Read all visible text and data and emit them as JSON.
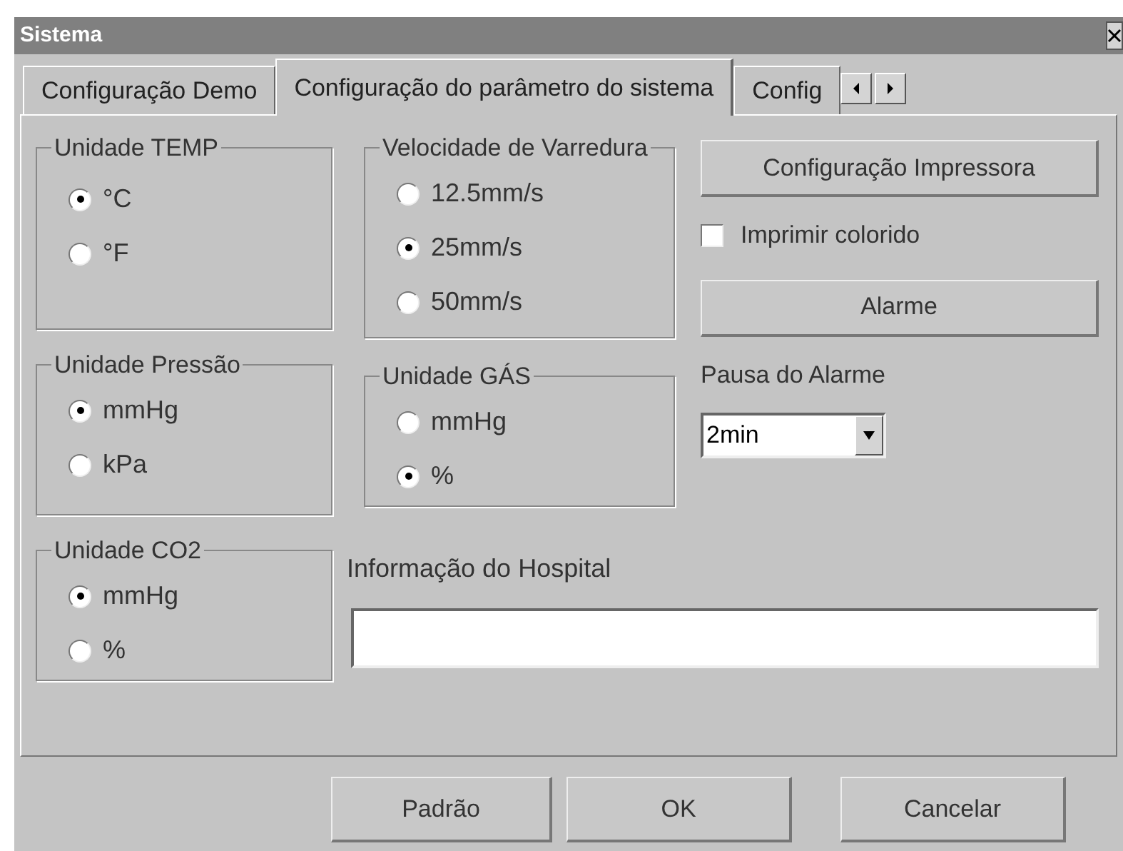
{
  "window": {
    "title": "Sistema"
  },
  "tabs": [
    {
      "label": "Configuração Demo",
      "selected": false
    },
    {
      "label": "Configuração do parâmetro do sistema",
      "selected": true
    },
    {
      "label": "Config",
      "selected": false
    }
  ],
  "groups_left": [
    {
      "title": "Unidade TEMP",
      "options": [
        {
          "label": "°C",
          "selected": true
        },
        {
          "label": "°F",
          "selected": false
        }
      ]
    },
    {
      "title": "Unidade Pressão",
      "options": [
        {
          "label": "mmHg",
          "selected": true
        },
        {
          "label": "kPa",
          "selected": false
        }
      ]
    },
    {
      "title": "Unidade CO2",
      "options": [
        {
          "label": "mmHg",
          "selected": true
        },
        {
          "label": "%",
          "selected": false
        }
      ]
    }
  ],
  "groups_middle": [
    {
      "title": "Velocidade de Varredura",
      "options": [
        {
          "label": "12.5mm/s",
          "selected": false
        },
        {
          "label": "25mm/s",
          "selected": true
        },
        {
          "label": "50mm/s",
          "selected": false
        }
      ]
    },
    {
      "title": "Unidade GÁS",
      "options": [
        {
          "label": "mmHg",
          "selected": false
        },
        {
          "label": "%",
          "selected": true
        }
      ]
    }
  ],
  "printer_button": "Configuração Impressora",
  "color_print": {
    "label": "Imprimir colorido",
    "checked": false
  },
  "alarm_button": "Alarme",
  "alarm_pause": {
    "label": "Pausa do Alarme",
    "value": "2min"
  },
  "hospital_info": {
    "label": "Informação do Hospital"
  },
  "buttons": [
    "Padrão",
    "OK",
    "Cancelar"
  ]
}
